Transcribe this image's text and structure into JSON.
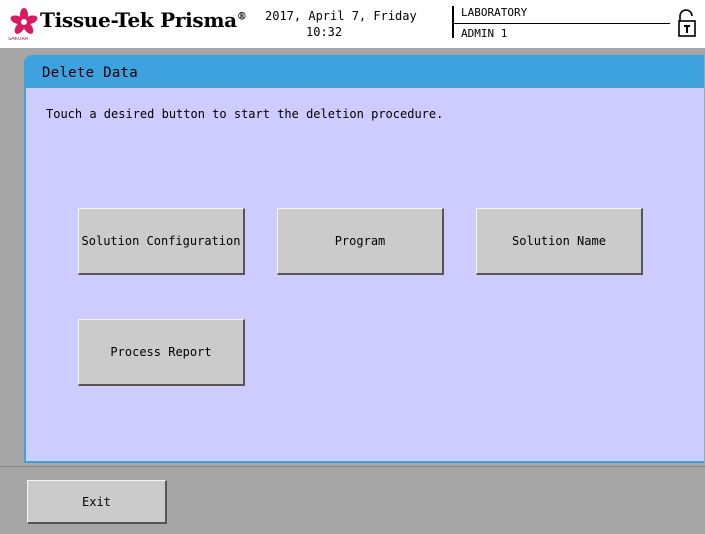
{
  "header": {
    "brand": "Tissue-Tek Prisma",
    "brand_mark": "®",
    "brand_sub": "SAKURA",
    "date": "2017, April 7, Friday",
    "time": "10:32",
    "organization": "LABORATORY",
    "user": "ADMIN 1"
  },
  "panel": {
    "title": "Delete Data",
    "instruction": "Touch a desired button to start the deletion procedure."
  },
  "buttons": {
    "solution_configuration": "Solution Configuration",
    "program": "Program",
    "solution_name": "Solution Name",
    "process_report": "Process Report"
  },
  "footer": {
    "exit": "Exit"
  },
  "colors": {
    "accent": "#3ea2df",
    "panel_bg": "#ccccff",
    "button_bg": "#cbcbcb",
    "footer_bg": "#a6a6a6",
    "logo": "#d81b60"
  },
  "icons": {
    "logo": "sakura-flower-icon",
    "lock": "lock-icon"
  }
}
